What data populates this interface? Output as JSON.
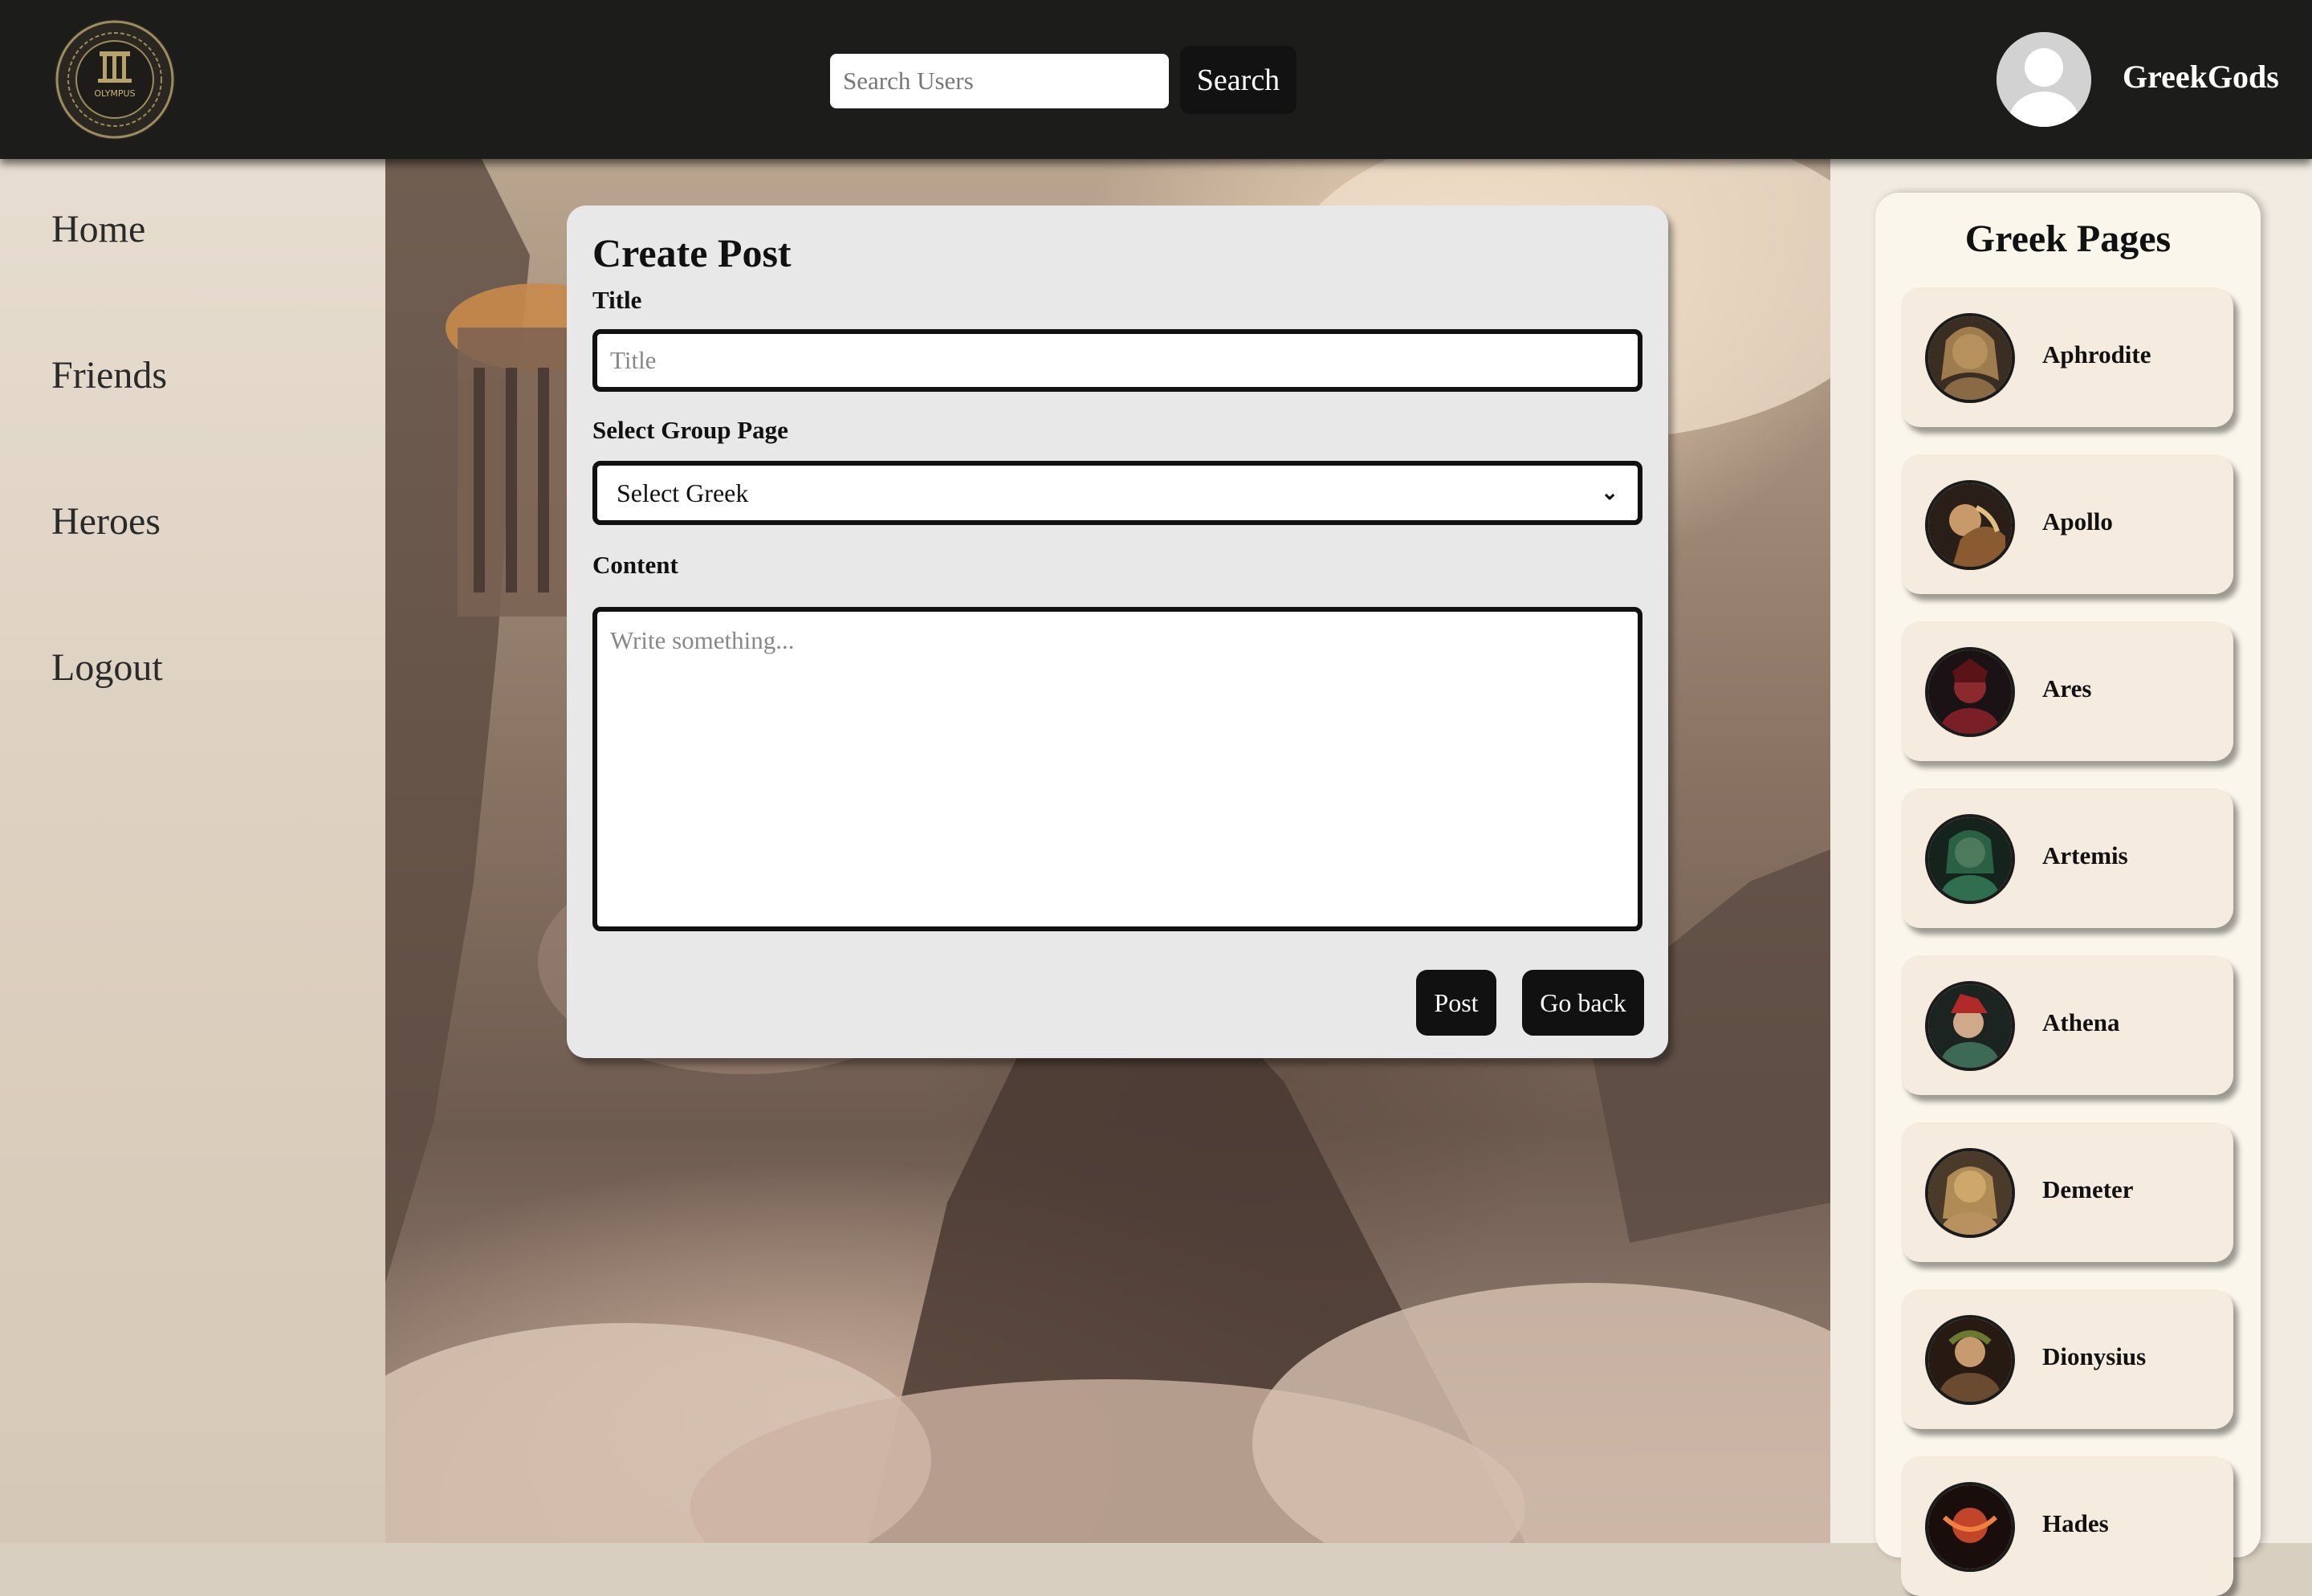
{
  "header": {
    "logo_text": "OLYMPUS",
    "search": {
      "placeholder": "Search Users",
      "value": "",
      "button_label": "Search"
    },
    "user": {
      "name": "GreekGods"
    }
  },
  "sidebar": {
    "items": [
      {
        "label": "Home"
      },
      {
        "label": "Friends"
      },
      {
        "label": "Heroes"
      },
      {
        "label": "Logout"
      }
    ]
  },
  "create_post": {
    "heading": "Create Post",
    "title_label": "Title",
    "title_placeholder": "Title",
    "group_label": "Select Group Page",
    "group_selected": "Select Greek",
    "content_label": "Content",
    "content_placeholder": "Write something...",
    "post_button": "Post",
    "back_button": "Go back"
  },
  "greek_pages": {
    "title": "Greek Pages",
    "items": [
      {
        "name": "Aphrodite",
        "color": "#b08a55"
      },
      {
        "name": "Apollo",
        "color": "#8a5a30"
      },
      {
        "name": "Ares",
        "color": "#7a1f25"
      },
      {
        "name": "Artemis",
        "color": "#2f6f4f"
      },
      {
        "name": "Athena",
        "color": "#3d6a55"
      },
      {
        "name": "Demeter",
        "color": "#b8915e"
      },
      {
        "name": "Dionysius",
        "color": "#6a4a30"
      },
      {
        "name": "Hades",
        "color": "#c0452a"
      }
    ]
  },
  "colors": {
    "topbar": "#1c1c1a",
    "button_dark": "#111111",
    "card_bg": "#e8e8e8",
    "god_card_bg": "#f5ebde"
  }
}
